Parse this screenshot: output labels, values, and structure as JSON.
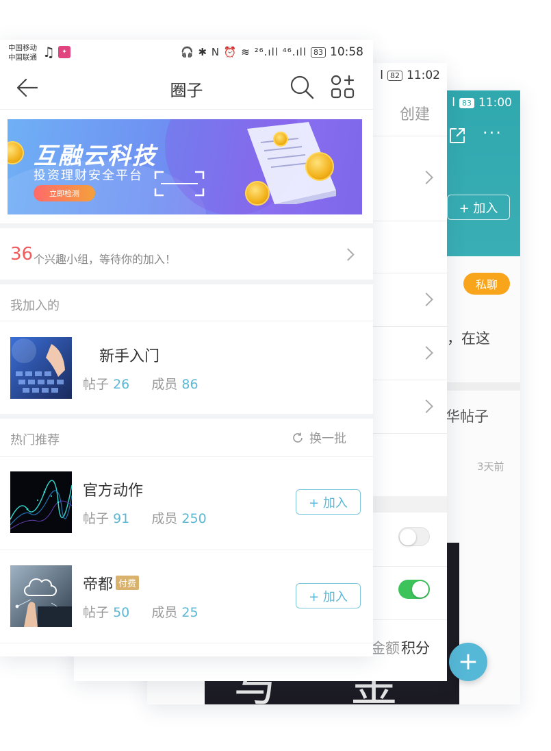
{
  "back_screen": {
    "status_time": "11:00",
    "battery": "83",
    "join_label": "+ 加入",
    "chat_badge": "私聊",
    "partial_text": "，在这",
    "hot_posts_partial": "华帖子",
    "time_ago": "3天前",
    "fab_symbol": "+",
    "accent_color": "#2fa8ae"
  },
  "middle_screen": {
    "status_time": "11:02",
    "battery": "82",
    "create_label": "创建",
    "balance_partial": "金额",
    "points_label": "积分",
    "toggle_1": "off",
    "toggle_2": "on"
  },
  "front_screen": {
    "status": {
      "carrier_1": "中国移动",
      "carrier_2": "中国联通",
      "network_icons": "🎧 ✱ N ⏰ ≋ ²⁶.ıll ⁴⁶.ıll",
      "battery": "83",
      "time": "10:58"
    },
    "nav": {
      "title": "圈子",
      "back_icon": "back-arrow-icon",
      "search_icon": "search-icon",
      "grid_icon": "add-grid-icon"
    },
    "banner": {
      "title": "互融云科技",
      "subtitle": "投资理财安全平台",
      "button": "立即检测"
    },
    "groups_row": {
      "count": "36",
      "text": "个兴趣小组，等待你的加入！"
    },
    "joined_section": {
      "title": "我加入的",
      "items": [
        {
          "name": "新手入门",
          "posts_label": "帖子",
          "posts": "26",
          "members_label": "成员",
          "members": "86"
        }
      ]
    },
    "hot_section": {
      "title": "热门推荐",
      "refresh_label": "换一批",
      "join_label": "+ 加入",
      "items": [
        {
          "name": "官方动作",
          "posts_label": "帖子",
          "posts": "91",
          "members_label": "成员",
          "members": "250",
          "paid_badge": ""
        },
        {
          "name": "帝都",
          "posts_label": "帖子",
          "posts": "50",
          "members_label": "成员",
          "members": "25",
          "paid_badge": "付费"
        }
      ]
    },
    "accent_color": "#5bb7d4",
    "count_color": "#f05b5b"
  }
}
